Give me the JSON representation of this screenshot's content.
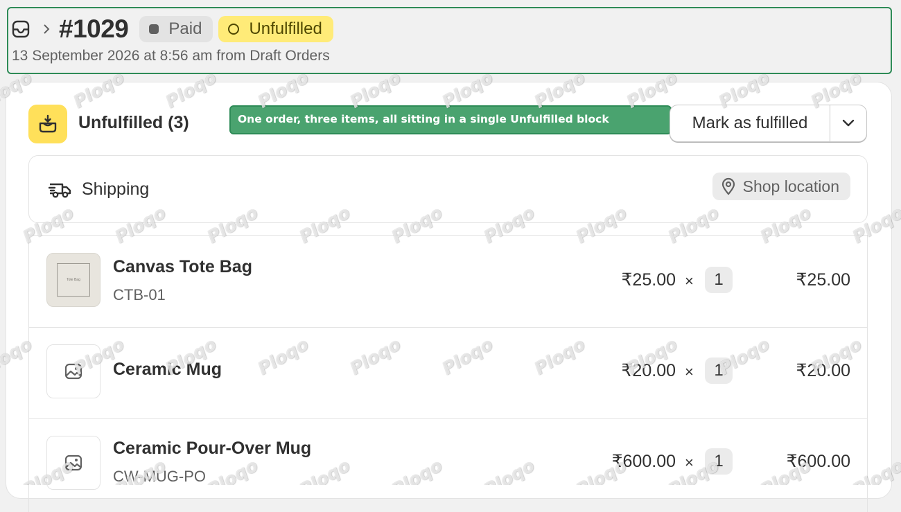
{
  "header": {
    "icon": "inbox-icon",
    "breadcrumb_separator_icon": "chevron-right-icon",
    "order_number": "#1029",
    "payment_badge": "Paid",
    "fulfillment_badge": "Unfulfilled",
    "subtitle": "13 September 2026 at 8:56 am from Draft Orders"
  },
  "fulfillment": {
    "icon": "package-fulfillment-icon",
    "title": "Unfulfilled (3)",
    "annotation": "One order, three items, all sitting in a single Unfulfilled block",
    "mark_button": "Mark as fulfilled",
    "dropdown_icon": "chevron-down-icon"
  },
  "shipping": {
    "icon": "truck-icon",
    "label": "Shipping",
    "location_icon": "location-pin-icon",
    "location": "Shop location"
  },
  "items": [
    {
      "name": "Canvas Tote Bag",
      "sku": "CTB-01",
      "price": "₹25.00",
      "times": "×",
      "qty": "1",
      "total": "₹25.00",
      "thumb_caption": "Tote Bag"
    },
    {
      "name": "Ceramic Mug",
      "sku": "",
      "price": "₹20.00",
      "times": "×",
      "qty": "1",
      "total": "₹20.00"
    },
    {
      "name": "Ceramic Pour-Over Mug",
      "sku": "CW-MUG-PO",
      "price": "₹600.00",
      "times": "×",
      "qty": "1",
      "total": "₹600.00"
    }
  ],
  "watermark": "Ploqo",
  "colors": {
    "paid_badge_bg": "#e3e3e3",
    "unfulfilled_badge_bg": "#ffeb78",
    "fulfill_icon_bg": "#ffe05a",
    "annotation_bg": "#4aa36f",
    "highlight_border": "#2e8b57"
  }
}
